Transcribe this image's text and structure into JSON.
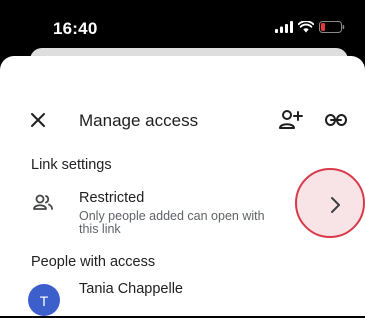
{
  "status_bar": {
    "time": "16:40",
    "icons": [
      "signal-icon",
      "wifi-icon",
      "battery-icon"
    ],
    "battery_color": "#e53935"
  },
  "header": {
    "close_icon": "close-icon",
    "title": "Manage access",
    "add_person_icon": "person-add-icon",
    "link_icon": "link-icon"
  },
  "link_settings": {
    "section_label": "Link settings",
    "icon": "people-icon",
    "title": "Restricted",
    "description": "Only people added can open with this link",
    "chevron_icon": "chevron-right-icon",
    "highlight_color": "#d93a4a"
  },
  "people_with_access": {
    "section_label": "People with access",
    "people": [
      {
        "initial": "T",
        "name": "Tania Chappelle",
        "avatar_color": "#3c5fcc"
      }
    ]
  }
}
